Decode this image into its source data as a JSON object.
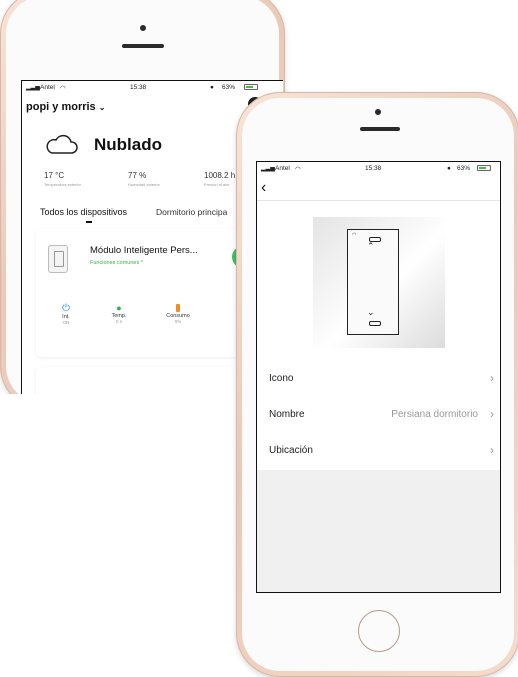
{
  "back_phone": {
    "status": {
      "carrier": "Antel",
      "time": "15:38",
      "battery": "63%"
    },
    "home_name": "popi y morris",
    "weather": {
      "condition": "Nublado"
    },
    "stats": [
      {
        "value": "17 °C",
        "caption": "Temperatura exterior"
      },
      {
        "value": "77 %",
        "caption": "Humedad exterior"
      },
      {
        "value": "1008.2 h",
        "caption": "Presión al aire"
      }
    ],
    "tabs": {
      "all": "Todos los dispositivos",
      "bedroom": "Dormitorio principa"
    },
    "device": {
      "name": "Módulo Inteligente Pers...",
      "subtitle": "Funciones comunes ^"
    },
    "functions": [
      {
        "label": "Int.",
        "value": "ON",
        "color": "#1e90ff"
      },
      {
        "label": "Temp.",
        "value": "0 s",
        "color": "#2db34a"
      },
      {
        "label": "Consumo",
        "value": "0%",
        "color": "#f08c2a"
      }
    ]
  },
  "front_phone": {
    "status": {
      "carrier": "Antel",
      "time": "15:38",
      "battery": "63%"
    },
    "menu": [
      {
        "label": "Icono",
        "value": ""
      },
      {
        "label": "Nombre",
        "value": "Persiana dormitorio"
      },
      {
        "label": "Ubicación",
        "value": ""
      }
    ]
  }
}
